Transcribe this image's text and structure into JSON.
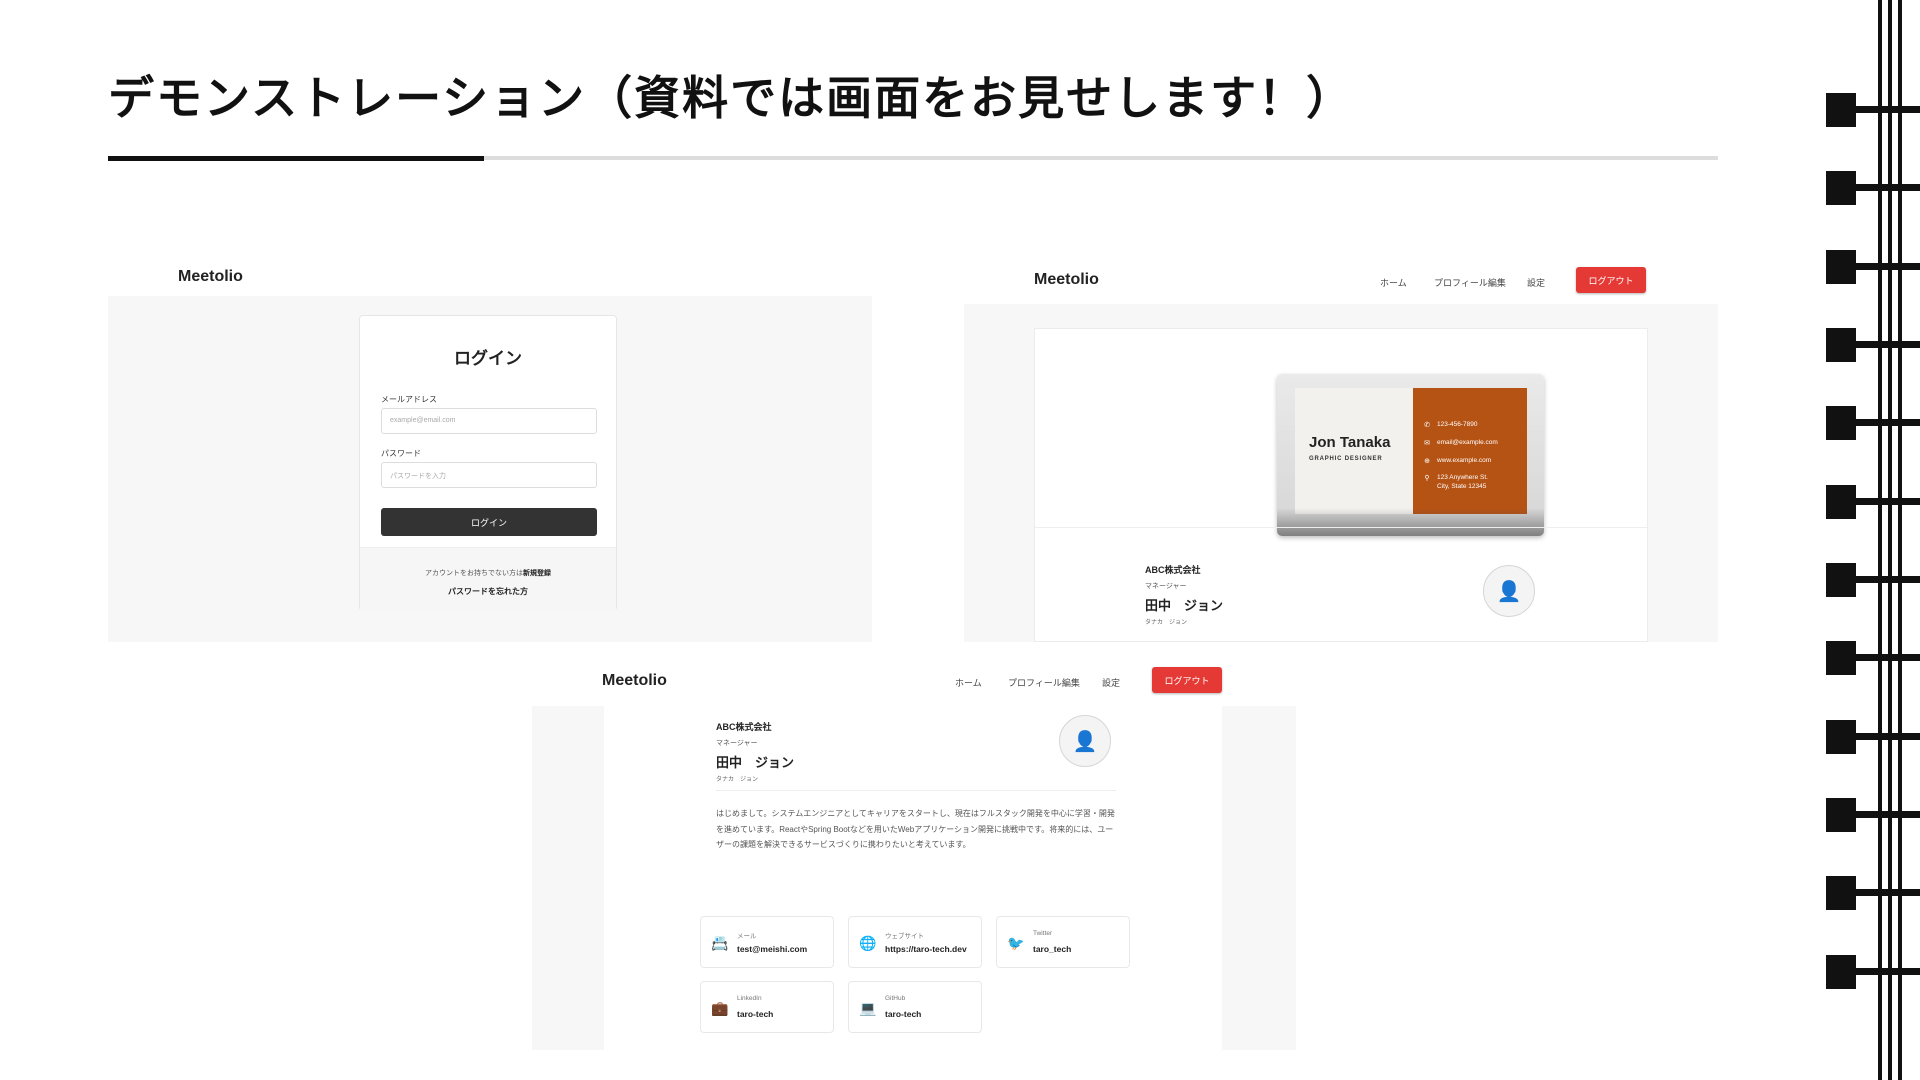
{
  "slide": {
    "title": "デモンストレーション（資料では画面をお見せします！）"
  },
  "app": {
    "brand": "Meetolio"
  },
  "nav": {
    "home": "ホーム",
    "profile_edit": "プロフィール編集",
    "settings": "設定",
    "logout": "ログアウト"
  },
  "login": {
    "title": "ログイン",
    "email_label": "メールアドレス",
    "email_placeholder": "example@email.com",
    "password_label": "パスワード",
    "password_placeholder": "パスワードを入力",
    "submit": "ログイン",
    "no_account_text": "アカウントをお持ちでない方は",
    "signup_link": "新規登録",
    "forgot_link": "パスワードを忘れた方"
  },
  "business_card": {
    "name": "Jon Tanaka",
    "role": "GRAPHIC DESIGNER",
    "phone": "123-456-7890",
    "email": "email@example.com",
    "website": "www.example.com",
    "address_line1": "123 Anywhere St.",
    "address_line2": "City, State 12345"
  },
  "profile": {
    "company": "ABC株式会社",
    "role": "マネージャー",
    "name": "田中　ジョン",
    "kana": "タナカ　ジョン",
    "bio": "はじめまして。システムエンジニアとしてキャリアをスタートし、現在はフルスタック開発を中心に学習・開発を進めています。ReactやSpring Bootなどを用いたWebアプリケーション開発に挑戦中です。将来的には、ユーザーの課題を解決できるサービスづくりに携わりたいと考えています。"
  },
  "links": [
    {
      "label": "メール",
      "value": "test@meishi.com",
      "icon": "email-card-icon"
    },
    {
      "label": "ウェブサイト",
      "value": "https://taro-tech.dev",
      "icon": "globe-icon"
    },
    {
      "label": "Twitter",
      "value": "taro_tech",
      "icon": "bird-icon"
    },
    {
      "label": "LinkedIn",
      "value": "taro-tech",
      "icon": "briefcase-icon"
    },
    {
      "label": "GitHub",
      "value": "taro-tech",
      "icon": "laptop-icon"
    }
  ],
  "colors": {
    "logout": "#e53935",
    "card_accent": "#b55314",
    "login_button": "#333333"
  }
}
